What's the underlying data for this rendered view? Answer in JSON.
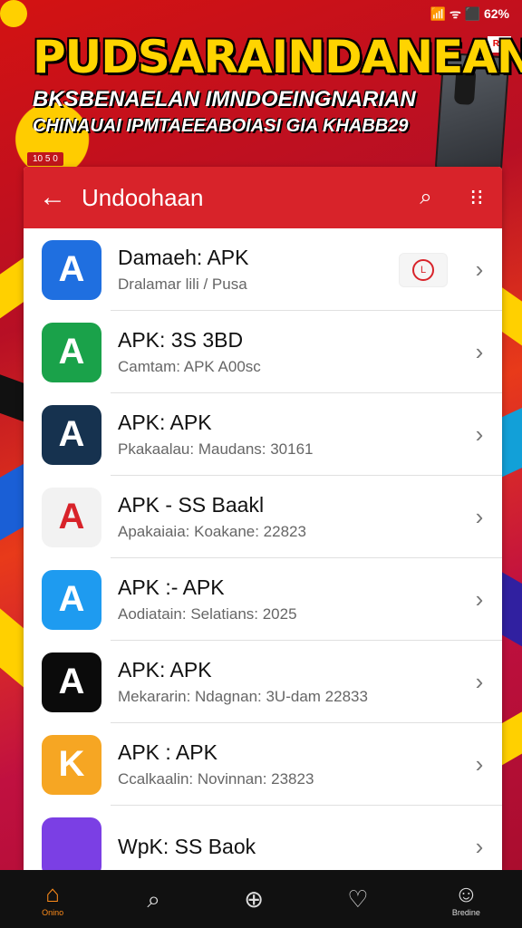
{
  "status_bar": {
    "text": "📶 ᯤ ⬛ 62%"
  },
  "banner": {
    "title": "PUDSARAINDANEAN",
    "subtitle1": "BKSBENAELAN IMNDOEINGNARIAN",
    "subtitle2": "CHINAUAI IPMTAEEABOIASI GIA KHABB29",
    "tag": "10 5 0"
  },
  "appbar": {
    "title": "Undoohaan"
  },
  "apps": [
    {
      "name": "Damaeh: APK",
      "meta": "Dralamar lili / Pusa",
      "color": "#1f6fe0",
      "glyph": "A",
      "has_badge": true
    },
    {
      "name": "APK: 3S 3BD",
      "meta": "Camtam: APK A00sc",
      "color": "#1aa24a",
      "glyph": "A",
      "has_badge": false
    },
    {
      "name": "APK: APK",
      "meta": "Pkakaalau: Maudans: 30161",
      "color": "#16324f",
      "glyph": "A",
      "has_badge": false
    },
    {
      "name": "APK - SS Baakl",
      "meta": "Apakaiaia: Koakane: 22823",
      "color": "#f2f2f2",
      "glyph": "A",
      "has_badge": false
    },
    {
      "name": "APK :- APK",
      "meta": "Aodiatain: Selatians: 2025",
      "color": "#1e9bf0",
      "glyph": "A",
      "has_badge": false
    },
    {
      "name": "APK: APK",
      "meta": "Mekararin: Ndagnan: 3U-dam 22833",
      "color": "#0b0b0b",
      "glyph": "A",
      "has_badge": false
    },
    {
      "name": "APK : APK",
      "meta": "Ccalkaalin: Novinnan: 23823",
      "color": "#f6a623",
      "glyph": "K",
      "has_badge": false
    },
    {
      "name": "WpK: SS Baok",
      "meta": "",
      "color": "#7b3fe4",
      "glyph": "",
      "has_badge": false
    }
  ],
  "nav": [
    {
      "icon": "home-icon",
      "glyph": "⌂",
      "label": "Onino",
      "active": true
    },
    {
      "icon": "search-icon",
      "glyph": "⌕",
      "label": "",
      "active": false
    },
    {
      "icon": "add-icon",
      "glyph": "⊕",
      "label": "",
      "active": false
    },
    {
      "icon": "heart-icon",
      "glyph": "♡",
      "label": "",
      "active": false
    },
    {
      "icon": "profile-icon",
      "glyph": "☺",
      "label": "Bredine",
      "active": false
    }
  ]
}
